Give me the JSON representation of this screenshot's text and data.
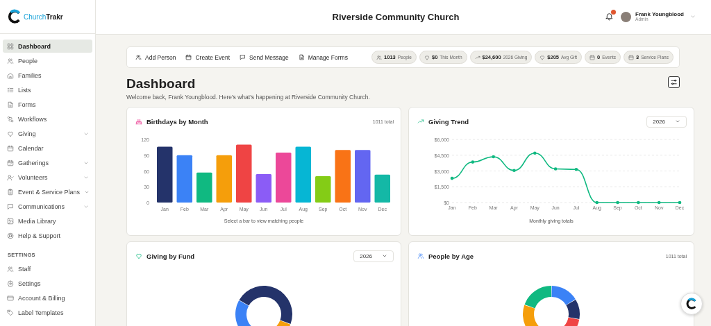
{
  "logo": {
    "part_1": "Church",
    "part_2": "Trakr"
  },
  "header": {
    "title": "Riverside Community Church",
    "notifications": {
      "unread": true
    },
    "user": {
      "name": "Frank Youngblood",
      "role": "Admin"
    }
  },
  "sidebar": {
    "items": [
      {
        "label": "Dashboard",
        "selected": true,
        "has_submenu": false
      },
      {
        "label": "People",
        "selected": false,
        "has_submenu": false
      },
      {
        "label": "Families",
        "selected": false,
        "has_submenu": false
      },
      {
        "label": "Lists",
        "selected": false,
        "has_submenu": false
      },
      {
        "label": "Forms",
        "selected": false,
        "has_submenu": false
      },
      {
        "label": "Workflows",
        "selected": false,
        "has_submenu": false
      },
      {
        "label": "Giving",
        "selected": false,
        "has_submenu": true
      },
      {
        "label": "Calendar",
        "selected": false,
        "has_submenu": false
      },
      {
        "label": "Gatherings",
        "selected": false,
        "has_submenu": true
      },
      {
        "label": "Volunteers",
        "selected": false,
        "has_submenu": true
      },
      {
        "label": "Event & Service Plans",
        "selected": false,
        "has_submenu": true
      },
      {
        "label": "Communications",
        "selected": false,
        "has_submenu": true
      },
      {
        "label": "Media Library",
        "selected": false,
        "has_submenu": false
      },
      {
        "label": "Help & Support",
        "selected": false,
        "has_submenu": false
      }
    ],
    "settings_heading": "SETTINGS",
    "settings_items": [
      {
        "label": "Staff",
        "selected": false
      },
      {
        "label": "Settings",
        "selected": false
      },
      {
        "label": "Account & Billing",
        "selected": false
      },
      {
        "label": "Label Templates",
        "selected": false
      }
    ]
  },
  "quick_actions": [
    "Add Person",
    "Create Event",
    "Send Message",
    "Manage Forms"
  ],
  "stats": [
    {
      "value": "1013",
      "label": "People"
    },
    {
      "value": "$0",
      "label": "This Month"
    },
    {
      "value": "$24,600",
      "label": "2026 Giving"
    },
    {
      "value": "$205",
      "label": "Avg Gift"
    },
    {
      "value": "0",
      "label": "Events"
    },
    {
      "value": "3",
      "label": "Service Plans"
    }
  ],
  "page": {
    "title": "Dashboard",
    "subtitle": "Welcome back, Frank Youngblood. Here's what's happening at Riverside Community Church."
  },
  "birthdays_card": {
    "title": "Birthdays by Month",
    "total": "1011 total",
    "caption": "Select a bar to view matching people",
    "chart_data": {
      "type": "bar",
      "categories": [
        "Jan",
        "Feb",
        "Mar",
        "Apr",
        "May",
        "Jun",
        "Jul",
        "Aug",
        "Sep",
        "Oct",
        "Nov",
        "Dec"
      ],
      "series": [
        {
          "values": [
            106,
            90,
            57,
            90,
            110,
            54,
            95,
            106,
            50,
            100,
            100,
            53
          ]
        }
      ],
      "colors": [
        "#24336a",
        "#3b82f6",
        "#10b981",
        "#f59e0b",
        "#ef4444",
        "#8b5cf6",
        "#ec4899",
        "#06b6d4",
        "#84cc16",
        "#f97316",
        "#6366f1",
        "#14b8a6"
      ],
      "ylim": [
        0,
        120
      ],
      "yticks": [
        0,
        30,
        60,
        90,
        120
      ]
    }
  },
  "giving_trend_card": {
    "title": "Giving Trend",
    "year": "2026",
    "caption": "Monthly giving totals",
    "chart_data": {
      "type": "line",
      "categories": [
        "Jan",
        "Feb",
        "Mar",
        "Apr",
        "May",
        "Jun",
        "Jul",
        "Aug",
        "Sep",
        "Oct",
        "Nov",
        "Dec"
      ],
      "grid": true,
      "series": [
        {
          "color": "#10b981",
          "values": [
            2300,
            3850,
            4350,
            3050,
            4700,
            3200,
            3150,
            0,
            0,
            0,
            0,
            0
          ]
        }
      ],
      "ylim": [
        0,
        6000
      ],
      "yticks": [
        {
          "value": 0,
          "label": "$0"
        },
        {
          "value": 1500,
          "label": "$1,500"
        },
        {
          "value": 3000,
          "label": "$3,000"
        },
        {
          "value": 4500,
          "label": "$4,500"
        },
        {
          "value": 6000,
          "label": "$6,000"
        }
      ]
    }
  },
  "giving_by_fund_card": {
    "title": "Giving by Fund",
    "year": "2026"
  },
  "people_by_age_card": {
    "title": "People by Age",
    "total": "1011 total"
  }
}
